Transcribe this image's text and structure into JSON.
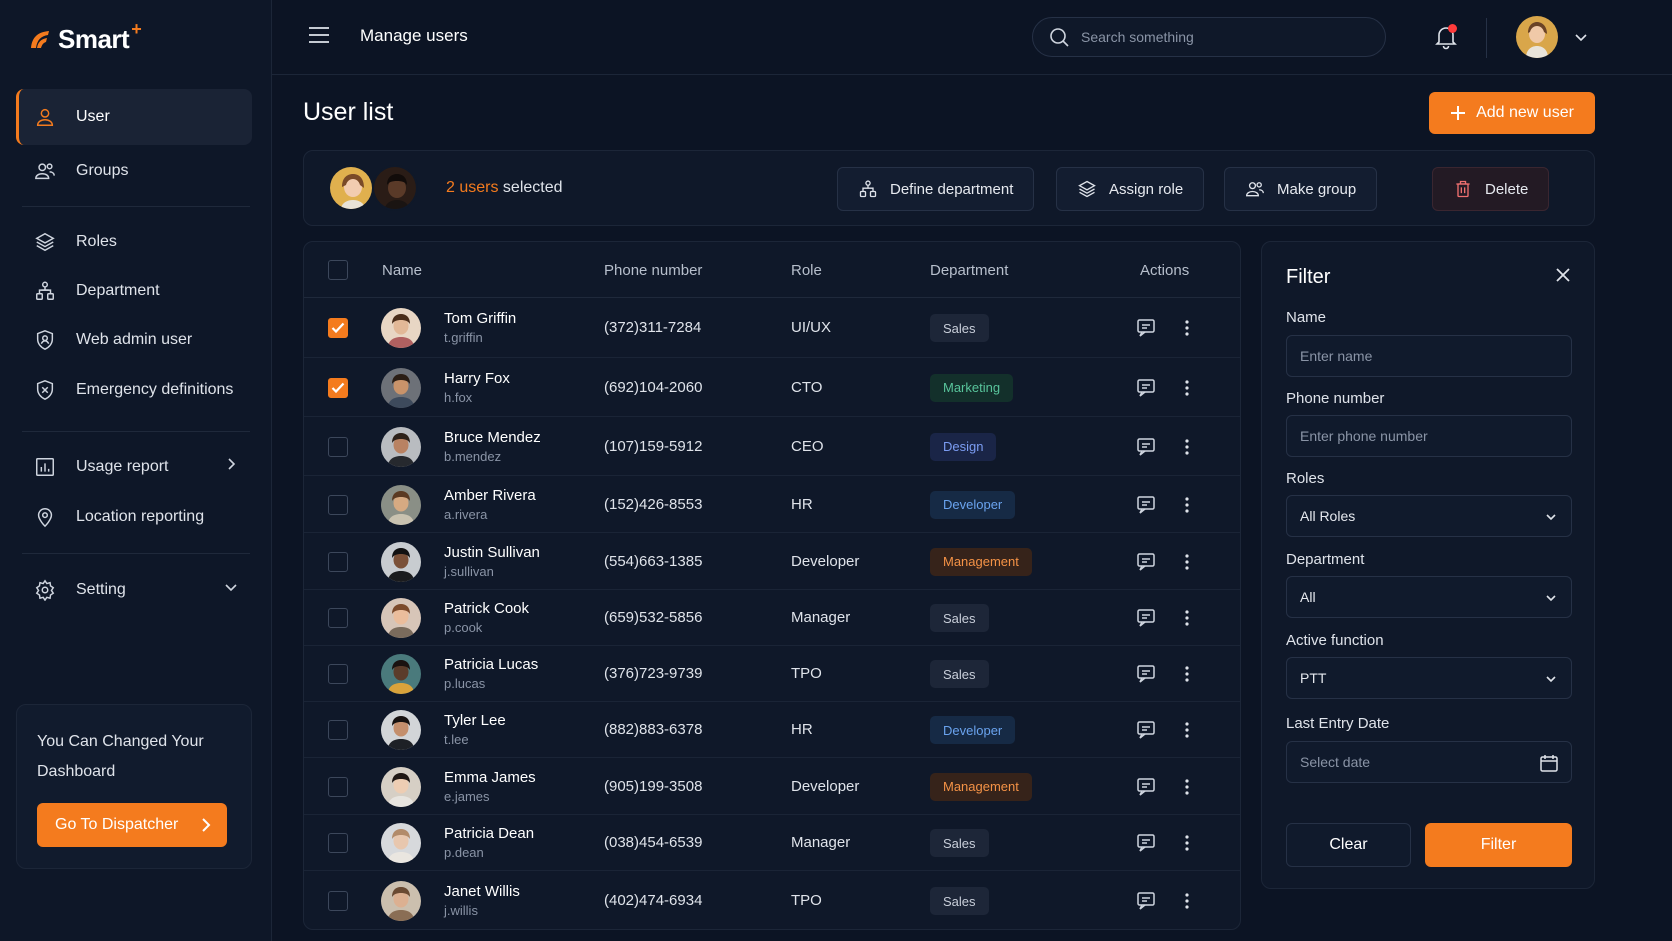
{
  "app": {
    "name": "Smart",
    "name_sup": "+"
  },
  "sidebar": {
    "items": [
      {
        "label": "User",
        "icon": "user-icon",
        "active": true
      },
      {
        "label": "Groups",
        "icon": "groups-icon"
      },
      {
        "label": "Roles",
        "icon": "layers-icon"
      },
      {
        "label": "Department",
        "icon": "department-icon"
      },
      {
        "label": "Web admin user",
        "icon": "admin-user-icon"
      },
      {
        "label": "Emergency definitions",
        "icon": "shield-icon"
      },
      {
        "label": "Usage report",
        "icon": "report-icon"
      },
      {
        "label": "Location reporting",
        "icon": "location-pin-icon"
      },
      {
        "label": "Setting",
        "icon": "gear-icon"
      }
    ],
    "promo": {
      "text": "You Can Changed Your Dashboard",
      "button": "Go To Dispatcher"
    }
  },
  "header": {
    "title": "Manage users",
    "search_placeholder": "Search something"
  },
  "page": {
    "title": "User list",
    "add_button": "Add new user"
  },
  "selection": {
    "count_label": "2 users",
    "suffix": " selected",
    "actions": [
      "Define department",
      "Assign role",
      "Make group",
      "Delete"
    ]
  },
  "table": {
    "columns": [
      "Name",
      "Phone number",
      "Role",
      "Department",
      "Actions"
    ],
    "rows": [
      {
        "name": "Tom Griffin",
        "username": "t.griffin",
        "phone": "(372)311-7284",
        "role": "UI/UX",
        "department": "Sales",
        "checked": true
      },
      {
        "name": "Harry Fox",
        "username": "h.fox",
        "phone": "(692)104-2060",
        "role": "CTO",
        "department": "Marketing",
        "checked": true
      },
      {
        "name": "Bruce Mendez",
        "username": "b.mendez",
        "phone": "(107)159-5912",
        "role": "CEO",
        "department": "Design",
        "checked": false
      },
      {
        "name": "Amber Rivera",
        "username": "a.rivera",
        "phone": "(152)426-8553",
        "role": "HR",
        "department": "Developer",
        "checked": false
      },
      {
        "name": "Justin Sullivan",
        "username": "j.sullivan",
        "phone": "(554)663-1385",
        "role": "Developer",
        "department": "Management",
        "checked": false
      },
      {
        "name": "Patrick Cook",
        "username": "p.cook",
        "phone": "(659)532-5856",
        "role": "Manager",
        "department": "Sales",
        "checked": false
      },
      {
        "name": "Patricia Lucas",
        "username": "p.lucas",
        "phone": "(376)723-9739",
        "role": "TPO",
        "department": "Sales",
        "checked": false
      },
      {
        "name": "Tyler Lee",
        "username": "t.lee",
        "phone": "(882)883-6378",
        "role": "HR",
        "department": "Developer",
        "checked": false
      },
      {
        "name": "Emma James",
        "username": "e.james",
        "phone": "(905)199-3508",
        "role": "Developer",
        "department": "Management",
        "checked": false
      },
      {
        "name": "Patricia Dean",
        "username": "p.dean",
        "phone": "(038)454-6539",
        "role": "Manager",
        "department": "Sales",
        "checked": false
      },
      {
        "name": "Janet Willis",
        "username": "j.willis",
        "phone": "(402)474-6934",
        "role": "TPO",
        "department": "Sales",
        "checked": false
      }
    ]
  },
  "filter": {
    "title": "Filter",
    "name_label": "Name",
    "name_placeholder": "Enter name",
    "phone_label": "Phone number",
    "phone_placeholder": "Enter phone number",
    "roles_label": "Roles",
    "roles_value": "All Roles",
    "department_label": "Department",
    "department_value": "All",
    "function_label": "Active function",
    "function_value": "PTT",
    "date_label": "Last Entry Date",
    "date_placeholder": "Select date",
    "clear_button": "Clear",
    "apply_button": "Filter"
  },
  "colors": {
    "accent": "#f47b1e",
    "background": "#0c1424",
    "panel": "#0f1829"
  }
}
